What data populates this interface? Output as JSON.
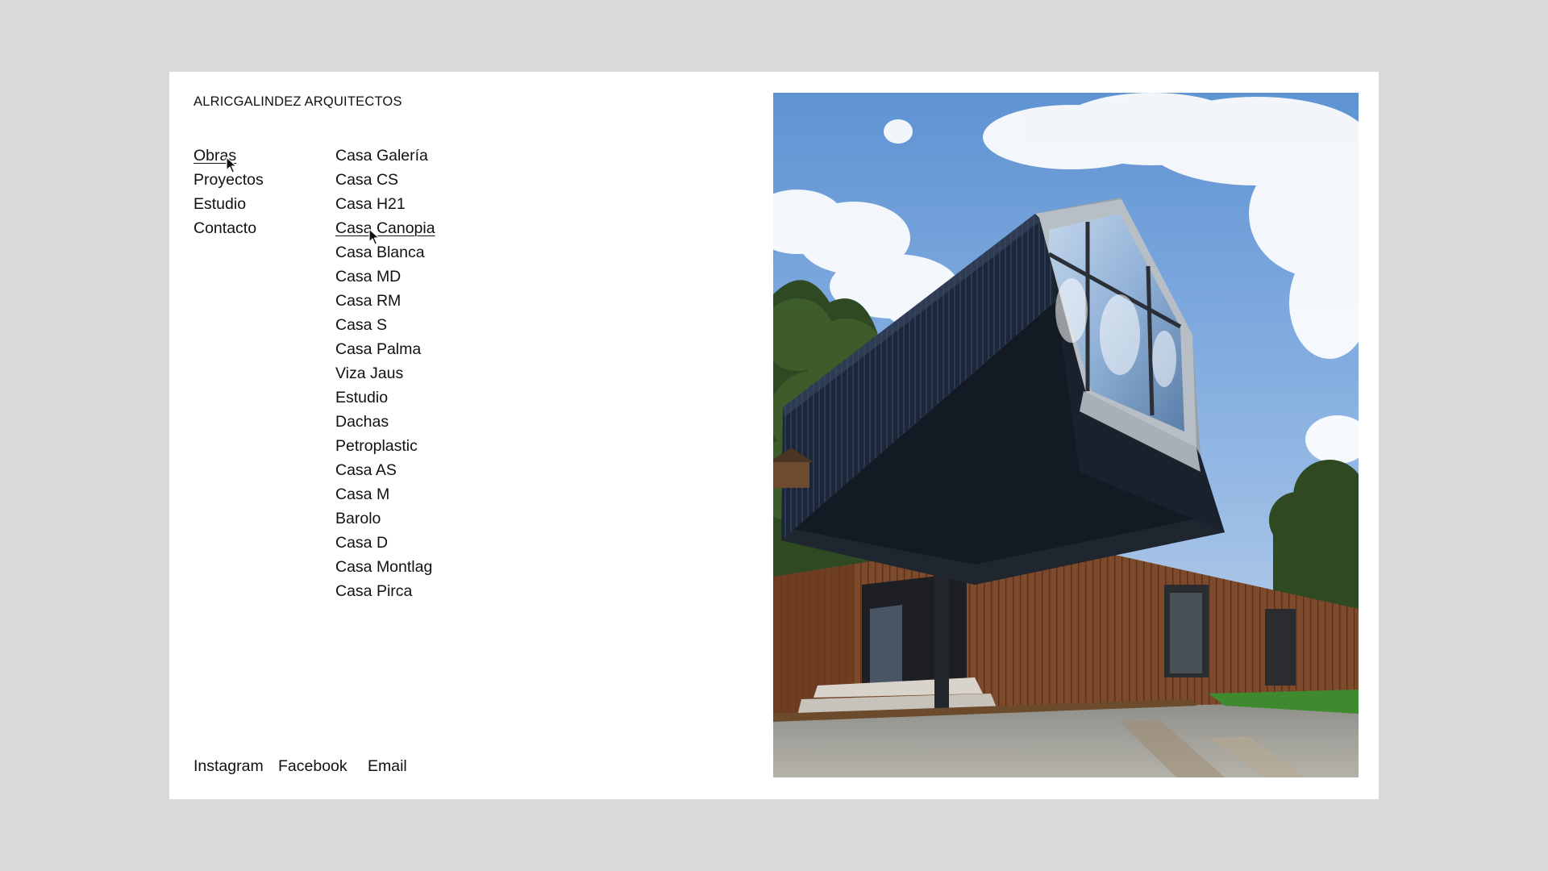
{
  "brand": "ALRICGALINDEZ ARQUITECTOS",
  "nav": [
    {
      "label": "Obras",
      "active": true
    },
    {
      "label": "Proyectos"
    },
    {
      "label": "Estudio"
    },
    {
      "label": "Contacto"
    }
  ],
  "works": [
    {
      "label": "Casa Galería"
    },
    {
      "label": "Casa CS"
    },
    {
      "label": "Casa H21"
    },
    {
      "label": "Casa Canopia",
      "hover": true
    },
    {
      "label": "Casa Blanca"
    },
    {
      "label": "Casa MD"
    },
    {
      "label": "Casa RM"
    },
    {
      "label": "Casa S"
    },
    {
      "label": "Casa Palma"
    },
    {
      "label": "Viza Jaus"
    },
    {
      "label": "Estudio"
    },
    {
      "label": "Dachas"
    },
    {
      "label": "Petroplastic"
    },
    {
      "label": "Casa AS"
    },
    {
      "label": "Casa M"
    },
    {
      "label": "Barolo"
    },
    {
      "label": "Casa D"
    },
    {
      "label": "Casa Montlag"
    },
    {
      "label": "Casa Pirca"
    }
  ],
  "social": {
    "instagram": "Instagram",
    "facebook": "Facebook",
    "email": "Email"
  },
  "colors": {
    "background": "#d9d9d9",
    "panel": "#ffffff",
    "text": "#111111"
  }
}
